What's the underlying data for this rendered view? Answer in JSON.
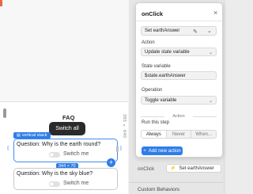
{
  "canvas": {
    "faq_title": "FAQ",
    "size_label": "365 × 640",
    "switch_all_label": "Switch all",
    "stack_tag_label": "vertical stack",
    "gap_label": "344 × 70",
    "add_symbol": "+",
    "questions": [
      {
        "question": "Question: Why is the earth round?",
        "toggle_label": "Switch me"
      },
      {
        "question": "Question: Why is the sky blue?",
        "toggle_label": "Switch me"
      }
    ]
  },
  "props": {
    "onclick_label": "onClick",
    "action_value": "Set earthAnswer",
    "custom_behaviors": "Custom Behaviors"
  },
  "popup": {
    "title": "onClick",
    "close": "×",
    "action_chip": "Set earthAnswer",
    "action_label": "Action",
    "action_value": "Update state variable",
    "state_var_label": "State variable",
    "state_var_value": "$state.earthAnswer",
    "operation_label": "Operation",
    "operation_value": "Toggle variable",
    "section_label": "Action",
    "run_label": "Run this step",
    "run_options": [
      "Always",
      "Never",
      "When..."
    ],
    "add_button": "Add new action",
    "add_icon": "+"
  },
  "colors": {
    "accent": "#2f7de8",
    "tooltip_bg": "#2a2a2a"
  }
}
